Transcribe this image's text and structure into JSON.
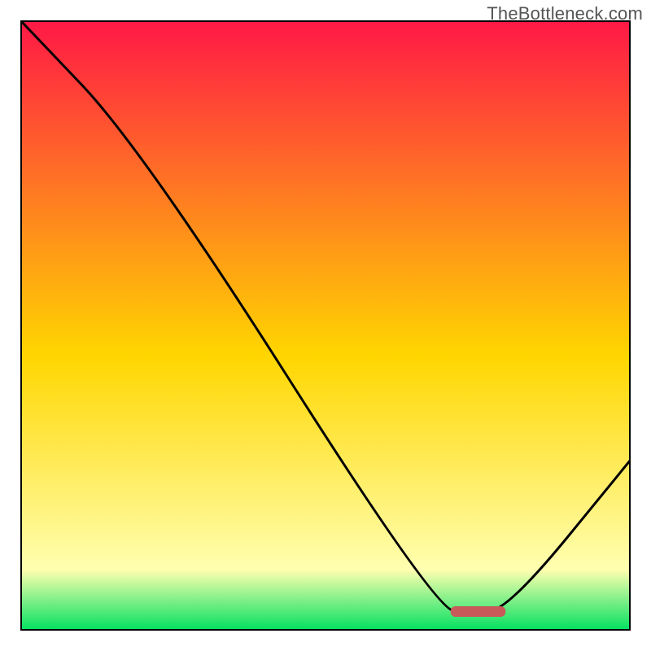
{
  "watermark": "TheBottleneck.com",
  "chart_data": {
    "type": "line",
    "title": "",
    "xlabel": "",
    "ylabel": "",
    "xlim": [
      0,
      100
    ],
    "ylim": [
      0,
      100
    ],
    "grid": false,
    "legend": false,
    "x": [
      0,
      20,
      68,
      74,
      80,
      100
    ],
    "values": [
      100,
      79,
      3.5,
      3,
      3.5,
      28
    ],
    "marker": {
      "x_start": 70.5,
      "x_end": 79.5,
      "y": 3.2,
      "color": "#c85a5a"
    },
    "gradient": {
      "top": "#ff1846",
      "mid": "#ffd600",
      "low": "#ffffb0",
      "bottom": "#00e060",
      "stops_pct": [
        0,
        55,
        90,
        100
      ]
    },
    "line_color": "#000000",
    "border_color": "#000000"
  }
}
